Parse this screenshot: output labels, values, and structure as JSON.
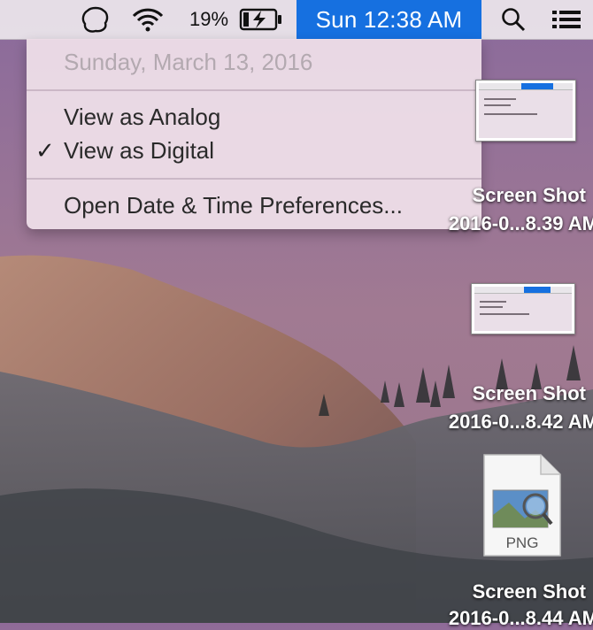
{
  "menubar": {
    "battery_percent": "19%",
    "clock": "Sun 12:38 AM",
    "icons": [
      "app-status-icon",
      "wifi-icon",
      "battery-charging-icon",
      "search-icon",
      "list-icon"
    ]
  },
  "clock_menu": {
    "date": "Sunday, March 13, 2016",
    "items": [
      {
        "label": "View as Analog",
        "checked": false
      },
      {
        "label": "View as Digital",
        "checked": true
      },
      {
        "label": "Open Date & Time Preferences..."
      }
    ],
    "check_glyph": "✓"
  },
  "desktop": {
    "files": [
      {
        "name": "Screen Shot",
        "subtitle": "2016-0...8.39 AM"
      },
      {
        "name": "Screen Shot",
        "subtitle": "2016-0...8.42 AM"
      },
      {
        "name": "Screen Shot",
        "subtitle": "2016-0...8.44 AM",
        "type_label": "PNG"
      }
    ]
  },
  "colors": {
    "accent": "#1670e0",
    "menu_bg": "#eedee8"
  }
}
